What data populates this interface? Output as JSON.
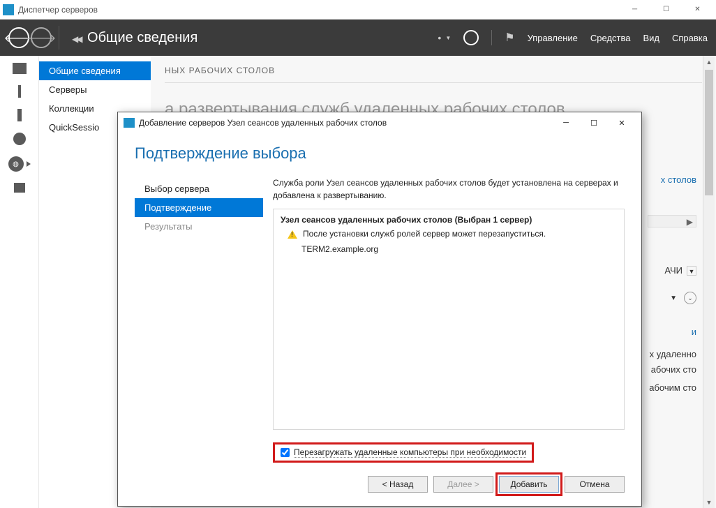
{
  "window": {
    "title": "Диспетчер серверов"
  },
  "header": {
    "title": "Общие сведения",
    "menu": {
      "manage": "Управление",
      "tools": "Средства",
      "view": "Вид",
      "help": "Справка"
    }
  },
  "nav": {
    "items": [
      "Общие сведения",
      "Серверы",
      "Коллекции",
      "QuickSessio"
    ]
  },
  "content": {
    "section_label": "НЫХ РАБОЧИХ СТОЛОВ",
    "faded_heading": "а развертывания служб удаленных рабочих столов",
    "bg_link1": "х столов",
    "bg_tasks": "АЧИ",
    "bg_link2": "и",
    "bg_text_lines": [
      "х удаленно",
      "абочих сто",
      "абочим сто"
    ]
  },
  "dialog": {
    "title": "Добавление серверов Узел сеансов удаленных рабочих столов",
    "heading": "Подтверждение выбора",
    "steps": {
      "select": "Выбор сервера",
      "confirm": "Подтверждение",
      "results": "Результаты"
    },
    "description": "Служба роли Узел сеансов удаленных рабочих столов будет установлена на серверах и добавлена к развертыванию.",
    "list_heading": "Узел сеансов удаленных рабочих столов  (Выбран 1 сервер)",
    "warning_text": "После установки служб ролей сервер может перезапуститься.",
    "server_name": "TERM2.example.org",
    "checkbox_label": "Перезагружать удаленные компьютеры при необходимости",
    "buttons": {
      "back": "< Назад",
      "next": "Далее >",
      "add": "Добавить",
      "cancel": "Отмена"
    }
  }
}
